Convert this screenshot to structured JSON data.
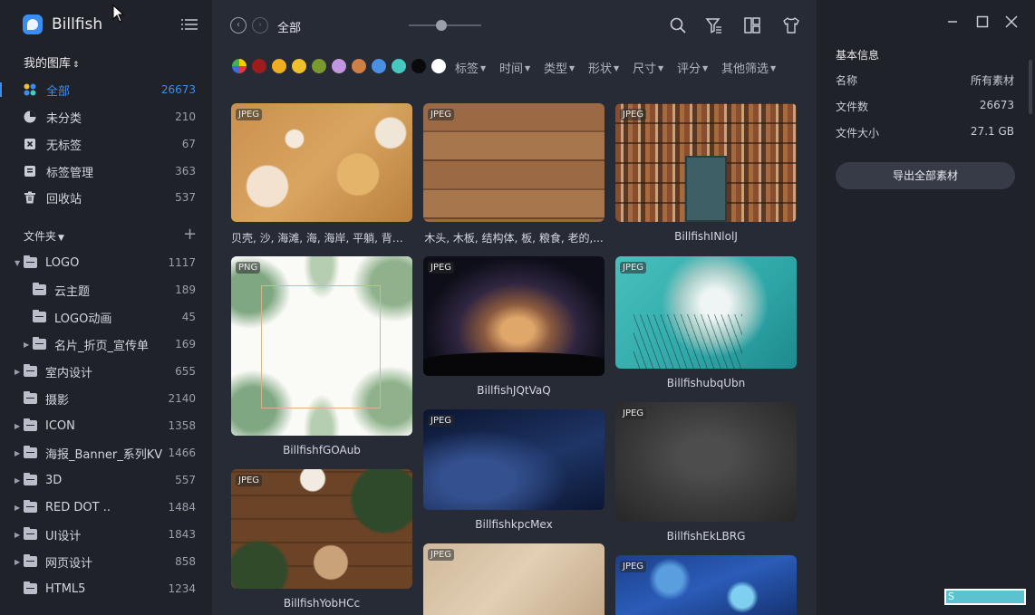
{
  "app": {
    "name": "Billfish"
  },
  "sidebar": {
    "library_label": "我的图库",
    "nav": [
      {
        "label": "全部",
        "count": "26673",
        "icon": "all-dots-icon"
      },
      {
        "label": "未分类",
        "count": "210",
        "icon": "pie-icon"
      },
      {
        "label": "无标签",
        "count": "67",
        "icon": "no-tag-icon"
      },
      {
        "label": "标签管理",
        "count": "363",
        "icon": "tag-manage-icon"
      },
      {
        "label": "回收站",
        "count": "537",
        "icon": "trash-icon"
      }
    ],
    "folders_label": "文件夹",
    "folders": [
      {
        "label": "LOGO",
        "count": "1117"
      },
      {
        "label": "云主题",
        "count": "189"
      },
      {
        "label": "LOGO动画",
        "count": "45"
      },
      {
        "label": "名片_折页_宣传单",
        "count": "169"
      },
      {
        "label": "室内设计",
        "count": "655"
      },
      {
        "label": "摄影",
        "count": "2140"
      },
      {
        "label": "ICON",
        "count": "1358"
      },
      {
        "label": "海报_Banner_系列KV",
        "count": "1466"
      },
      {
        "label": "3D",
        "count": "557"
      },
      {
        "label": "RED DOT ..",
        "count": "1484"
      },
      {
        "label": "UI设计",
        "count": "1843"
      },
      {
        "label": "网页设计",
        "count": "858"
      },
      {
        "label": "HTML5",
        "count": "1234"
      }
    ]
  },
  "toolbar": {
    "breadcrumb": "全部",
    "zoom_fraction": 0.45,
    "icons": [
      "search-icon",
      "filter-icon",
      "layout-icon",
      "shirt-icon"
    ]
  },
  "color_filters": [
    "#f0d000",
    "#9e1c1c",
    "#f0ad1f",
    "#f0c02a",
    "#7a9a2e",
    "#c295e0",
    "#d07f45",
    "#4a90e2",
    "#45c8c0",
    "#0a0a0a",
    "#ffffff"
  ],
  "filters": [
    "标签",
    "时间",
    "类型",
    "形状",
    "尺寸",
    "评分",
    "其他筛选"
  ],
  "grid": [
    {
      "badge": "JPEG",
      "caption": "贝壳, 沙, 海滩, 海, 海岸, 平躺, 背景,..."
    },
    {
      "badge": "JPEG",
      "caption": "木头, 木板, 结构体, 板, 粮食, 老的,..."
    },
    {
      "badge": "JPEG",
      "caption": "BillfishINlolJ"
    },
    {
      "badge": "PNG",
      "caption": "BillfishfGOAub"
    },
    {
      "badge": "JPEG",
      "caption": "BillfishJQtVaQ"
    },
    {
      "badge": "JPEG",
      "caption": "BillfishubqUbn"
    },
    {
      "badge": "JPEG",
      "caption": "BillfishYobHCc"
    },
    {
      "badge": "JPEG",
      "caption": "BillfishkpcMex"
    },
    {
      "badge": "JPEG",
      "caption": "BillfishEkLBRG"
    },
    {
      "badge": "JPEG",
      "caption": ""
    },
    {
      "badge": "JPEG",
      "caption": ""
    }
  ],
  "info": {
    "title": "基本信息",
    "rows": [
      {
        "key": "名称",
        "value": "所有素材"
      },
      {
        "key": "文件数",
        "value": "26673"
      },
      {
        "key": "文件大小",
        "value": "27.1 GB"
      }
    ],
    "export_label": "导出全部素材"
  },
  "watermark": "S"
}
